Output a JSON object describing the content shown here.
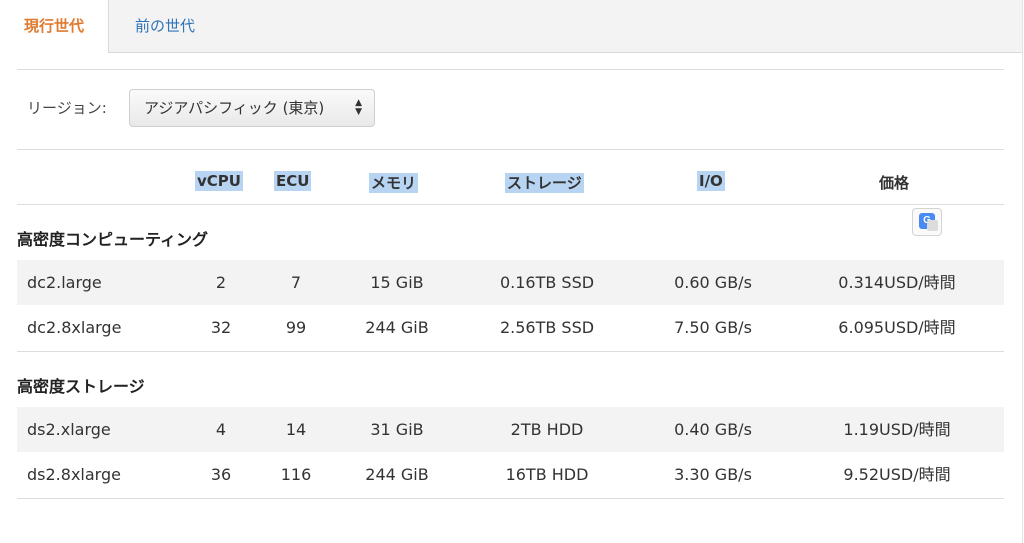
{
  "tabs": [
    {
      "label": "現行世代",
      "active": true
    },
    {
      "label": "前の世代",
      "active": false
    }
  ],
  "region": {
    "label": "リージョン:",
    "selected": "アジアパシフィック (東京)"
  },
  "columns": [
    "vCPU",
    "ECU",
    "メモリ",
    "ストレージ",
    "I/O",
    "価格"
  ],
  "sections": [
    {
      "title": "高密度コンピューティング",
      "rows": [
        {
          "name": "dc2.large",
          "vcpu": "2",
          "ecu": "7",
          "memory": "15 GiB",
          "storage": "0.16TB SSD",
          "io": "0.60 GB/s",
          "price": "0.314USD/時間"
        },
        {
          "name": "dc2.8xlarge",
          "vcpu": "32",
          "ecu": "99",
          "memory": "244 GiB",
          "storage": "2.56TB SSD",
          "io": "7.50 GB/s",
          "price": "6.095USD/時間"
        }
      ]
    },
    {
      "title": "高密度ストレージ",
      "rows": [
        {
          "name": "ds2.xlarge",
          "vcpu": "4",
          "ecu": "14",
          "memory": "31 GiB",
          "storage": "2TB HDD",
          "io": "0.40 GB/s",
          "price": "1.19USD/時間"
        },
        {
          "name": "ds2.8xlarge",
          "vcpu": "36",
          "ecu": "116",
          "memory": "244 GiB",
          "storage": "16TB HDD",
          "io": "3.30 GB/s",
          "price": "9.52USD/時間"
        }
      ]
    }
  ],
  "icons": {
    "translate": "google-translate-icon"
  },
  "colors": {
    "active_tab": "#e07a2e",
    "inactive_tab": "#2e73b8",
    "highlight": "#b7d4f2",
    "row_shade": "#f3f3f3"
  }
}
